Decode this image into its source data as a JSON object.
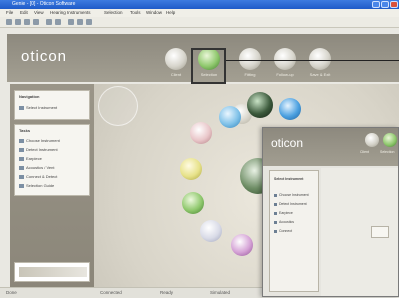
{
  "window": {
    "title": "Genie - [0] - Oticon Software"
  },
  "menu": [
    "File",
    "Edit",
    "View",
    "Hearing Instruments",
    "Selection",
    "Tools",
    "Window",
    "Help"
  ],
  "header": {
    "logo": "oticon",
    "nav": [
      {
        "label": "Client",
        "icon": "client-icon"
      },
      {
        "label": "Selection",
        "icon": "selection-icon"
      },
      {
        "label": "Fitting",
        "icon": "fitting-icon"
      },
      {
        "label": "Follow-up",
        "icon": "follow-up-icon"
      },
      {
        "label": "Save & Exit",
        "icon": "save-exit-icon"
      }
    ]
  },
  "sidebar": {
    "box1_title": "Navigation",
    "box1_items": [
      "Select Instrument"
    ],
    "box2_title": "Tasks",
    "box2_items": [
      "Choose Instrument",
      "Detect Instrument",
      "Earpiece",
      "Acoustics / Vent",
      "Connect & Detect",
      "Selection Guide"
    ],
    "card_label": ""
  },
  "statusbar": {
    "items": [
      "Done",
      "Connected",
      "Ready",
      "Simulated"
    ]
  },
  "inset": {
    "logo": "oticon",
    "nav": [
      "Client",
      "Selection"
    ],
    "items": [
      "Select Instrument",
      "Choose Instrument",
      "Detect Instrument",
      "Earpiece",
      "Acoustics",
      "Connect"
    ]
  },
  "colors": {
    "titlebar": "#1f5bc8",
    "header": "#9a9588",
    "selected_nav": "#8fc86d"
  }
}
